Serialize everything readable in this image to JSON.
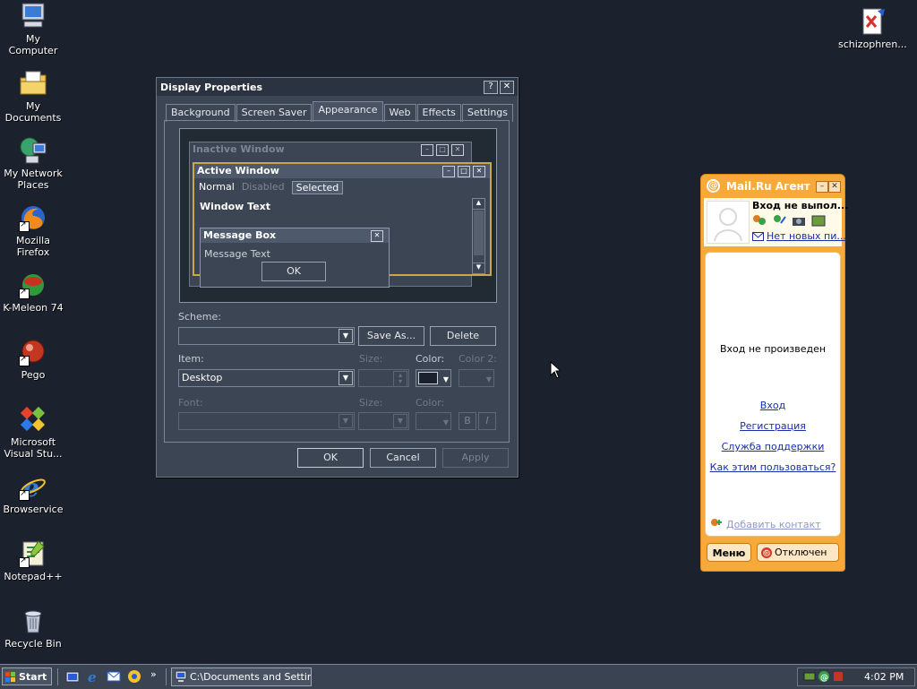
{
  "desktop": {
    "icons": [
      {
        "label": "My Computer",
        "icon": "my-computer-icon"
      },
      {
        "label": "My Documents",
        "icon": "my-documents-icon"
      },
      {
        "label": "My Network Places",
        "icon": "network-places-icon"
      },
      {
        "label": "Mozilla Firefox",
        "icon": "firefox-icon"
      },
      {
        "label": "K-Meleon 74",
        "icon": "k-meleon-icon"
      },
      {
        "label": "Pego",
        "icon": "pego-icon"
      },
      {
        "label": "Microsoft Visual Stu...",
        "icon": "visual-studio-icon"
      },
      {
        "label": "Browservice",
        "icon": "internet-explorer-icon"
      },
      {
        "label": "Notepad++",
        "icon": "notepad-plus-plus-icon"
      },
      {
        "label": "Recycle Bin",
        "icon": "recycle-bin-icon"
      },
      {
        "label": "schizophren...",
        "icon": "document-file-icon"
      }
    ]
  },
  "display_properties": {
    "title": "Display Properties",
    "help_btn": "?",
    "close_btn": "✕",
    "tabs": [
      "Background",
      "Screen Saver",
      "Appearance",
      "Web",
      "Effects",
      "Settings"
    ],
    "active_tab": "Appearance",
    "preview": {
      "inactive_title": "Inactive Window",
      "active_title": "Active Window",
      "menu": [
        "Normal",
        "Disabled",
        "Selected"
      ],
      "window_text": "Window Text",
      "msgbox_title": "Message Box",
      "msgbox_text": "Message Text",
      "msgbox_ok": "OK"
    },
    "scheme_label": "Scheme:",
    "scheme_value": "",
    "save_as": "Save As...",
    "delete": "Delete",
    "item_label": "Item:",
    "item_value": "Desktop",
    "size_label": "Size:",
    "color_label": "Color:",
    "color2_label": "Color 2:",
    "font_label": "Font:",
    "font_size_label": "Size:",
    "font_color_label": "Color:",
    "bold_btn": "B",
    "italic_btn": "I",
    "ok": "OK",
    "cancel": "Cancel",
    "apply": "Apply"
  },
  "mailru": {
    "title": "Mail.Ru Агент",
    "status": "Вход не выпол...",
    "no_new": "Нет новых пи...",
    "center_text": "Вход не произведен",
    "links": [
      "Вход",
      "Регистрация",
      "Служба поддержки",
      "Как этим пользоваться?"
    ],
    "add_contact": "Добавить контакт",
    "menu_btn": "Меню",
    "offline_btn": "Отключен"
  },
  "taskbar": {
    "start": "Start",
    "task": "C:\\Documents and Settin...",
    "clock": "4:02 PM",
    "more": "»"
  },
  "colors": {
    "desktop": "#1c212e",
    "window": "#3c4553",
    "mailru_orange": "#f7a93a",
    "link": "#1a2ea6"
  }
}
